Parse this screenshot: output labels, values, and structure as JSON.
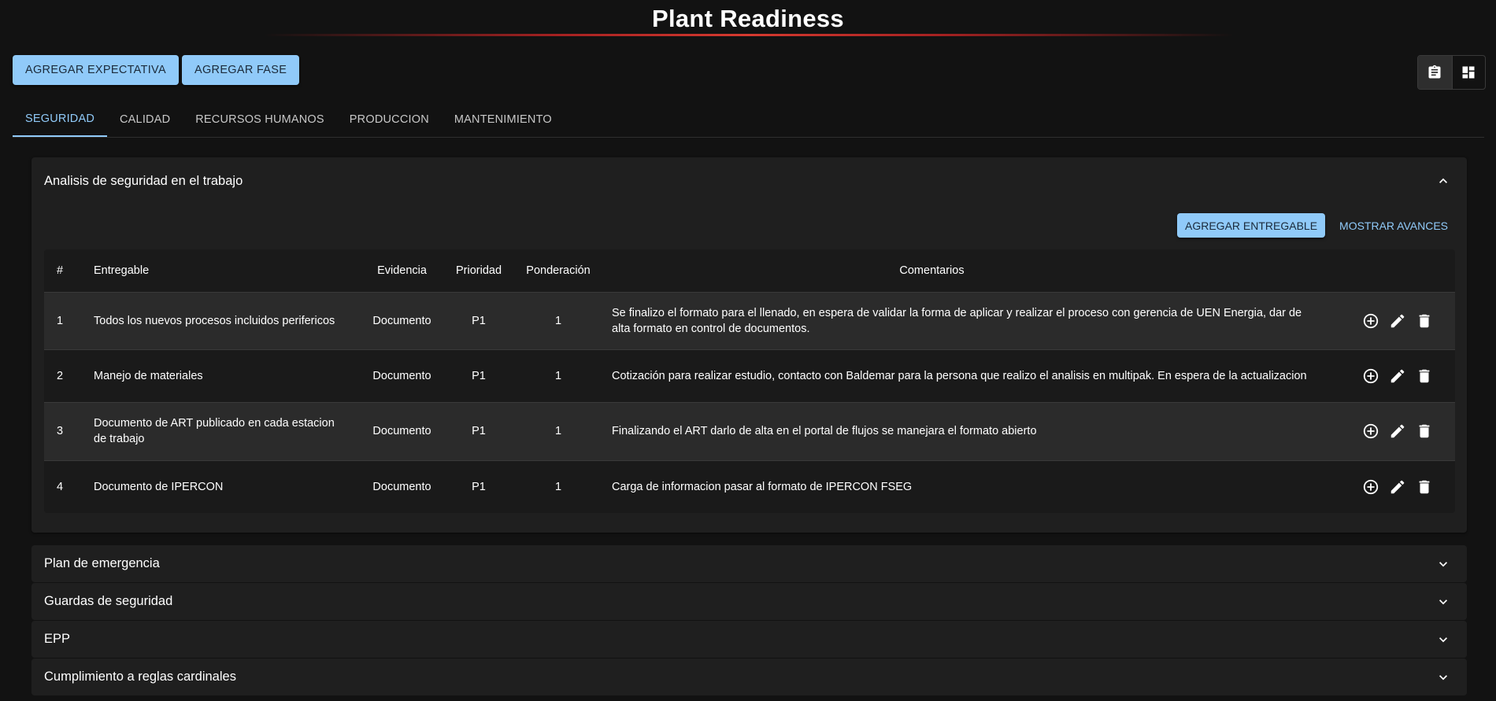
{
  "header": {
    "title": "Plant Readiness"
  },
  "toolbar": {
    "add_expectation_label": "AGREGAR EXPECTATIVA",
    "add_phase_label": "AGREGAR FASE",
    "view_toggle": [
      {
        "icon": "clipboard-icon",
        "selected": true
      },
      {
        "icon": "dashboard-grid-icon",
        "selected": false
      }
    ]
  },
  "tabs": [
    {
      "label": "SEGURIDAD",
      "active": true
    },
    {
      "label": "CALIDAD",
      "active": false
    },
    {
      "label": "RECURSOS HUMANOS",
      "active": false
    },
    {
      "label": "PRODUCCION",
      "active": false
    },
    {
      "label": "MANTENIMIENTO",
      "active": false
    }
  ],
  "sections": [
    {
      "title": "Analisis de seguridad en el trabajo",
      "expanded": true,
      "add_deliverable_label": "AGREGAR ENTREGABLE",
      "show_progress_label": "MOSTRAR AVANCES",
      "table": {
        "headers": {
          "num": "#",
          "deliverable": "Entregable",
          "evidence": "Evidencia",
          "priority": "Prioridad",
          "weight": "Ponderación",
          "comments": "Comentarios"
        },
        "rows": [
          {
            "num": "1",
            "deliverable": "Todos los nuevos procesos incluidos perifericos",
            "evidence": "Documento",
            "priority": "P1",
            "weight": "1",
            "comments": "Se finalizo el formato para el llenado, en espera de validar la forma de aplicar y realizar el proceso con gerencia de UEN Energia, dar de alta formato en control de documentos."
          },
          {
            "num": "2",
            "deliverable": "Manejo de materiales",
            "evidence": "Documento",
            "priority": "P1",
            "weight": "1",
            "comments": "Cotización para realizar estudio, contacto con Baldemar para la persona que realizo el analisis en multipak. En espera de la actualizacion"
          },
          {
            "num": "3",
            "deliverable": "Documento de ART publicado en cada estacion de trabajo",
            "evidence": "Documento",
            "priority": "P1",
            "weight": "1",
            "comments": "Finalizando el ART darlo de alta en el portal de flujos se manejara el formato abierto"
          },
          {
            "num": "4",
            "deliverable": "Documento de IPERCON",
            "evidence": "Documento",
            "priority": "P1",
            "weight": "1",
            "comments": "Carga de informacion pasar al formato de IPERCON FSEG"
          }
        ]
      }
    },
    {
      "title": "Plan de emergencia",
      "expanded": false
    },
    {
      "title": "Guardas de seguridad",
      "expanded": false
    },
    {
      "title": "EPP",
      "expanded": false
    },
    {
      "title": "Cumplimiento a reglas cardinales",
      "expanded": false
    }
  ],
  "colors": {
    "accent": "#90caf9",
    "background": "#121212",
    "panel": "#1f1f1f",
    "title_underline": "#d63a30"
  }
}
